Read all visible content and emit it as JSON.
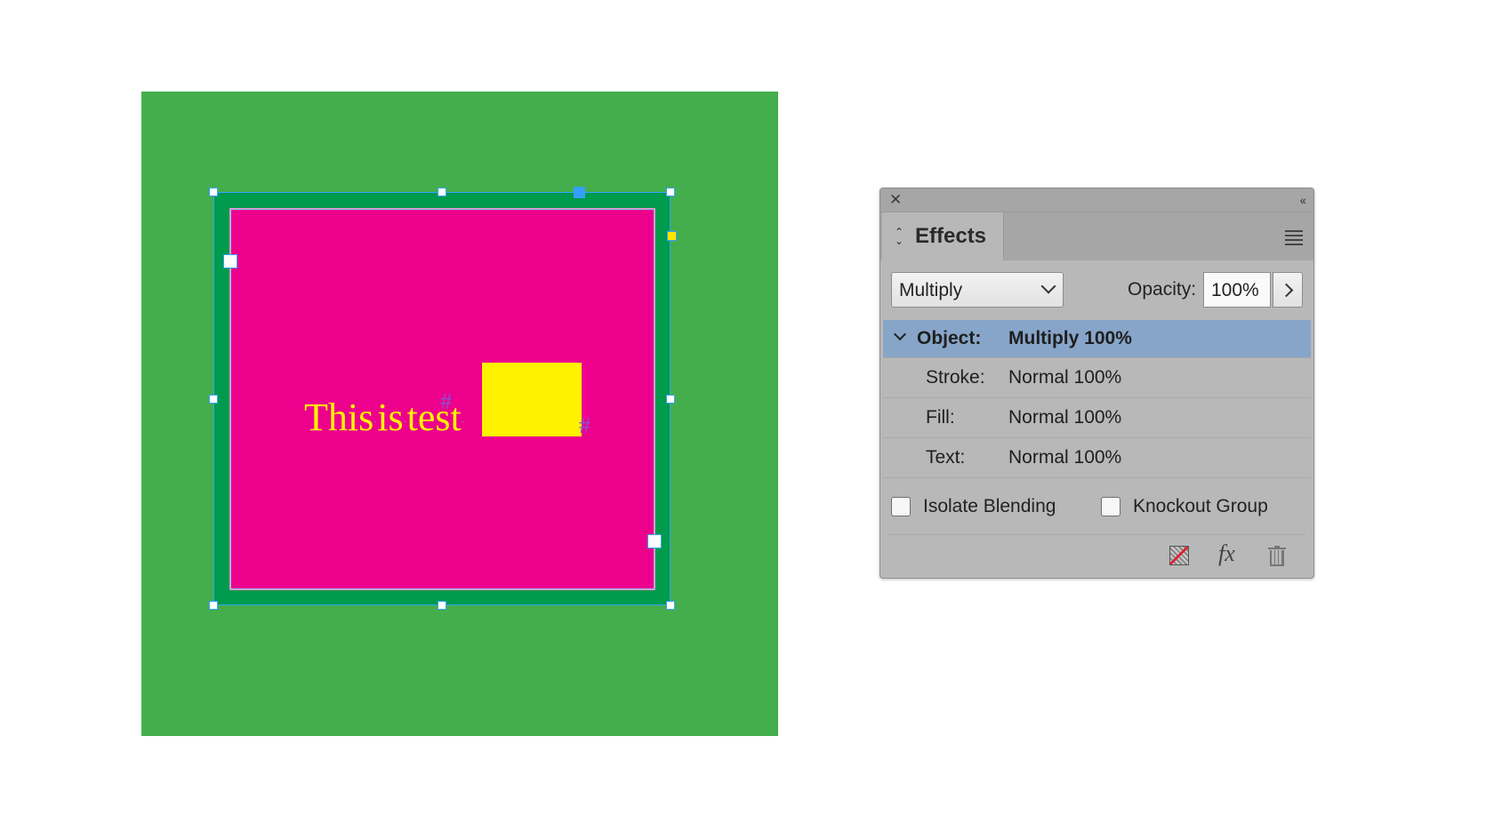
{
  "canvas": {
    "text": "This is test",
    "hash_glyph": "#",
    "colors": {
      "page": "#43ae4b",
      "frame_stroke": "#009b4c",
      "frame_fill": "#ec008c",
      "text": "#fff200",
      "anchored_object": "#fff200",
      "selection": "#35a0ff"
    }
  },
  "panel": {
    "title_icons": {
      "close": "close-icon",
      "collapse": "double-chevron-left-icon"
    },
    "tab_label": "Effects",
    "blend_mode": {
      "selected": "Multiply"
    },
    "opacity": {
      "label": "Opacity:",
      "value": "100%"
    },
    "rows": [
      {
        "label": "Object:",
        "value": "Multiply 100%",
        "selected": true
      },
      {
        "label": "Stroke:",
        "value": "Normal 100%"
      },
      {
        "label": "Fill:",
        "value": "Normal 100%"
      },
      {
        "label": "Text:",
        "value": "Normal 100%"
      }
    ],
    "isolate_blending": {
      "label": "Isolate Blending",
      "checked": false
    },
    "knockout_group": {
      "label": "Knockout Group",
      "checked": false
    },
    "footer_icons": [
      "clear-effects-icon",
      "fx-icon",
      "trash-icon"
    ],
    "fx_glyph": "fx",
    "selected_row_color": "#87a5c8"
  }
}
